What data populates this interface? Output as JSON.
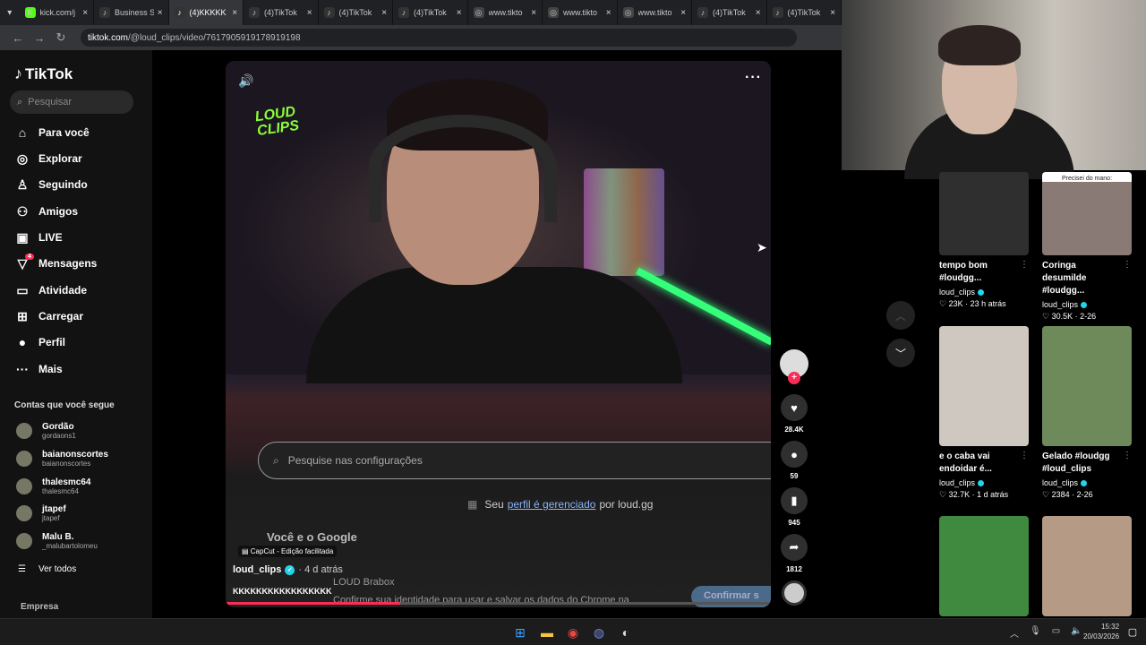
{
  "browser": {
    "tabs": [
      {
        "title": "kick.com/j",
        "icon": "K",
        "color": "#53fc18"
      },
      {
        "title": "Business S",
        "icon": "♪",
        "color": "#333"
      },
      {
        "title": "(4)KKKKK",
        "icon": "♪",
        "color": "#333"
      },
      {
        "title": "(4)TikTok",
        "icon": "♪",
        "color": "#333"
      },
      {
        "title": "(4)TikTok",
        "icon": "♪",
        "color": "#333"
      },
      {
        "title": "(4)TikTok",
        "icon": "♪",
        "color": "#333"
      },
      {
        "title": "www.tikto",
        "icon": "◎",
        "color": "#444"
      },
      {
        "title": "www.tikto",
        "icon": "◎",
        "color": "#444"
      },
      {
        "title": "www.tikto",
        "icon": "◎",
        "color": "#444"
      },
      {
        "title": "(4)TikTok",
        "icon": "♪",
        "color": "#333"
      },
      {
        "title": "(4)TikTok",
        "icon": "♪",
        "color": "#333"
      }
    ],
    "url_host": "tiktok.com",
    "url_path": "/@loud_clips/video/7617905919178919198"
  },
  "sidebar": {
    "logo": "TikTok",
    "search_placeholder": "Pesquisar",
    "nav": [
      {
        "label": "Para você",
        "icon": "⌂"
      },
      {
        "label": "Explorar",
        "icon": "◎"
      },
      {
        "label": "Seguindo",
        "icon": "♙"
      },
      {
        "label": "Amigos",
        "icon": "⚇"
      },
      {
        "label": "LIVE",
        "icon": "▣"
      },
      {
        "label": "Mensagens",
        "icon": "▽",
        "badge": "4"
      },
      {
        "label": "Atividade",
        "icon": "▭"
      },
      {
        "label": "Carregar",
        "icon": "⊞"
      },
      {
        "label": "Perfil",
        "icon": "●"
      },
      {
        "label": "Mais",
        "icon": "···"
      }
    ],
    "following_title": "Contas que você segue",
    "following": [
      {
        "name": "Gordão",
        "handle": "gordaons1"
      },
      {
        "name": "baianonscortes",
        "handle": "baianonscortes"
      },
      {
        "name": "thalesmc64",
        "handle": "thalesmc64"
      },
      {
        "name": "jtapef",
        "handle": "jtapef"
      },
      {
        "name": "Malu B.",
        "handle": "_malubartolomeu"
      }
    ],
    "see_all": "Ver todos",
    "company": "Empresa"
  },
  "video": {
    "overlay_logo_top": "LOUD",
    "overlay_logo_bottom": "CLIPS",
    "settings_search": "Pesquise nas configurações",
    "managed_prefix": "Seu",
    "managed_link": "perfil é gerenciado",
    "managed_suffix": "por loud.gg",
    "voce_google": "Você e o Google",
    "capcut": "CapCut - Edição facilitada",
    "author": "loud_clips",
    "posted": "· 4 d atrás",
    "caption": "KKKKKKKKKKKKKKKKK",
    "brabox_title": "LOUD Brabox",
    "brabox_text": "Confirme sua identidade para usar e salvar os dados do Chrome na",
    "confirm": "Confirmar s",
    "progress": 0.32
  },
  "actions": {
    "likes": "28.4K",
    "comments": "59",
    "saves": "945",
    "shares": "1812"
  },
  "grid": [
    {
      "title": "tempo bom #loudgg...",
      "user": "loud_clips",
      "stats": "♡ 23K · 23 h atrás",
      "thumb_text": "",
      "color": "#2f2f2f"
    },
    {
      "title": "Coringa desumilde #loudgg...",
      "user": "loud_clips",
      "stats": "♡ 30.5K · 2-26",
      "thumb_text": "Precisei do mano:",
      "color": "#8a7a76"
    },
    {
      "title": "e o caba vai endoidar é...",
      "user": "loud_clips",
      "stats": "♡ 32.7K · 1 d atrás",
      "thumb_text": "",
      "color": "#cfc8c0"
    },
    {
      "title": "Gelado #loudgg #loud_clips",
      "user": "loud_clips",
      "stats": "♡ 2384 · 2-26",
      "thumb_text": "",
      "color": "#6f8a5a"
    },
    {
      "title": "",
      "user": "",
      "stats": "",
      "thumb_text": "",
      "color": "#3f8a3f"
    },
    {
      "title": "",
      "user": "",
      "stats": "",
      "thumb_text": "",
      "color": "#b59a85"
    }
  ],
  "clock": {
    "time": "15:32",
    "date": "20/03/2026"
  }
}
